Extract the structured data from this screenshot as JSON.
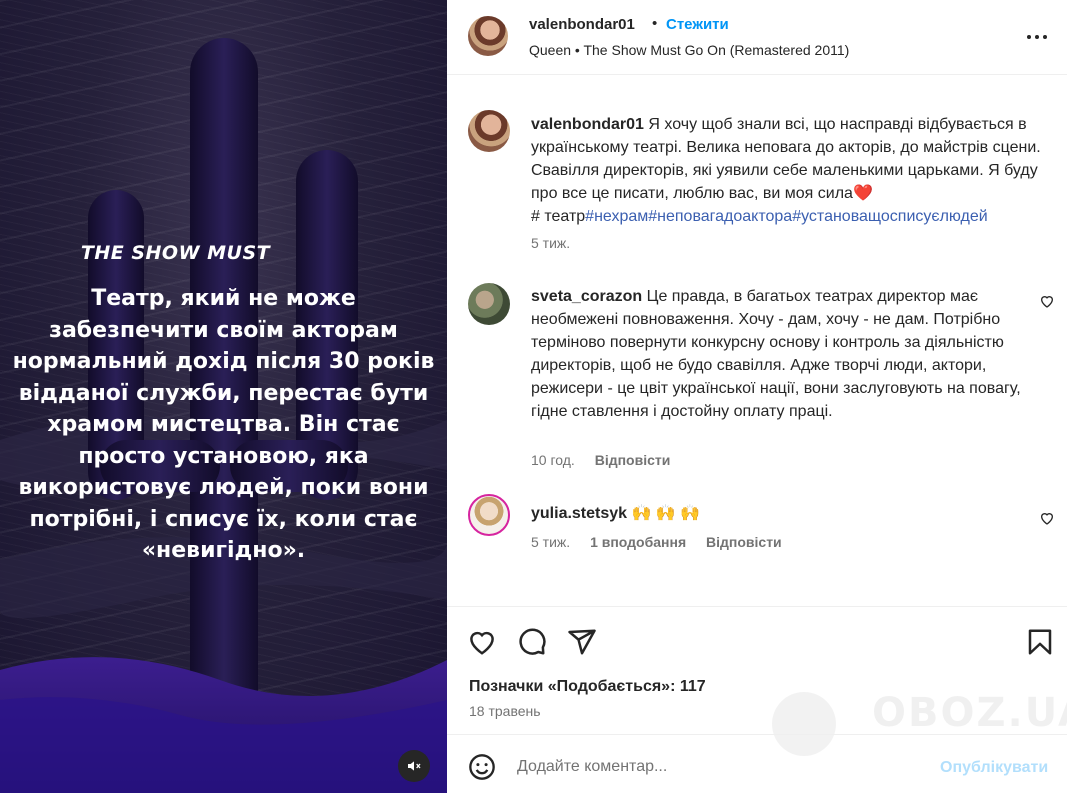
{
  "story": {
    "heading": "THE SHOW MUST",
    "body": "Театр, який не може забезпечити своїм акторам нормальний дохід після 30 років відданої служби, перестає бути храмом мистецтва. Він стає просто установою, яка використовує людей, поки вони потрібні, і списує їх, коли стає «невигідно».",
    "mute_icon": "speaker-muted-icon"
  },
  "header": {
    "username": "valenbondar01",
    "dot": "•",
    "follow_label": "Стежити",
    "music": "Queen • The Show Must Go On (Remastered 2011)",
    "more_icon": "more-horizontal-icon"
  },
  "caption": {
    "username": "valenbondar01",
    "text": "Я хочу щоб знали всі, що насправді відбувається в українському театрі. Велика неповага до акторів, до майстрів сцени. Свавілля директорів, які уявили себе маленькими царьками. Я буду про все це писати, люблю вас, ви моя сила",
    "heart_emoji": "❤️",
    "hash_prefix": "# театр",
    "tags": "#нехрам#неповагадоактора#установащосписуєлюдей",
    "time": "5 тиж."
  },
  "comments": [
    {
      "username": "sveta_corazon",
      "text": "Це правда, в багатьох театрах директор має необмежені повноваження. Хочу - дам, хочу - не дам. Потрібно терміново повернути конкурсну основу і контроль за діяльністю директорів, щоб не будо свавілля. Адже творчі люди, актори, режисери - це цвіт української нації, вони заслуговують на повагу, гідне ставлення і достойну оплату праці.",
      "time": "10 год.",
      "reply_label": "Відповісти"
    },
    {
      "username": "yulia.stetsyk",
      "text": "🙌 🙌 🙌",
      "time": "5 тиж.",
      "likes_label": "1 вподобання",
      "reply_label": "Відповісти"
    }
  ],
  "actions": {
    "icons": [
      "heart-icon",
      "comment-icon",
      "share-icon",
      "bookmark-icon"
    ],
    "likes_text": "Позначки «Подобається»: 117",
    "date": "18 травень"
  },
  "add_comment": {
    "placeholder": "Додайте коментар...",
    "publish_label": "Опублікувати"
  },
  "watermark": "OBOZ.UA",
  "colors": {
    "accent": "#0095f6",
    "publish_disabled": "#b2dffc",
    "tag": "#3b5fb0",
    "like_heart": "#ed4956"
  }
}
